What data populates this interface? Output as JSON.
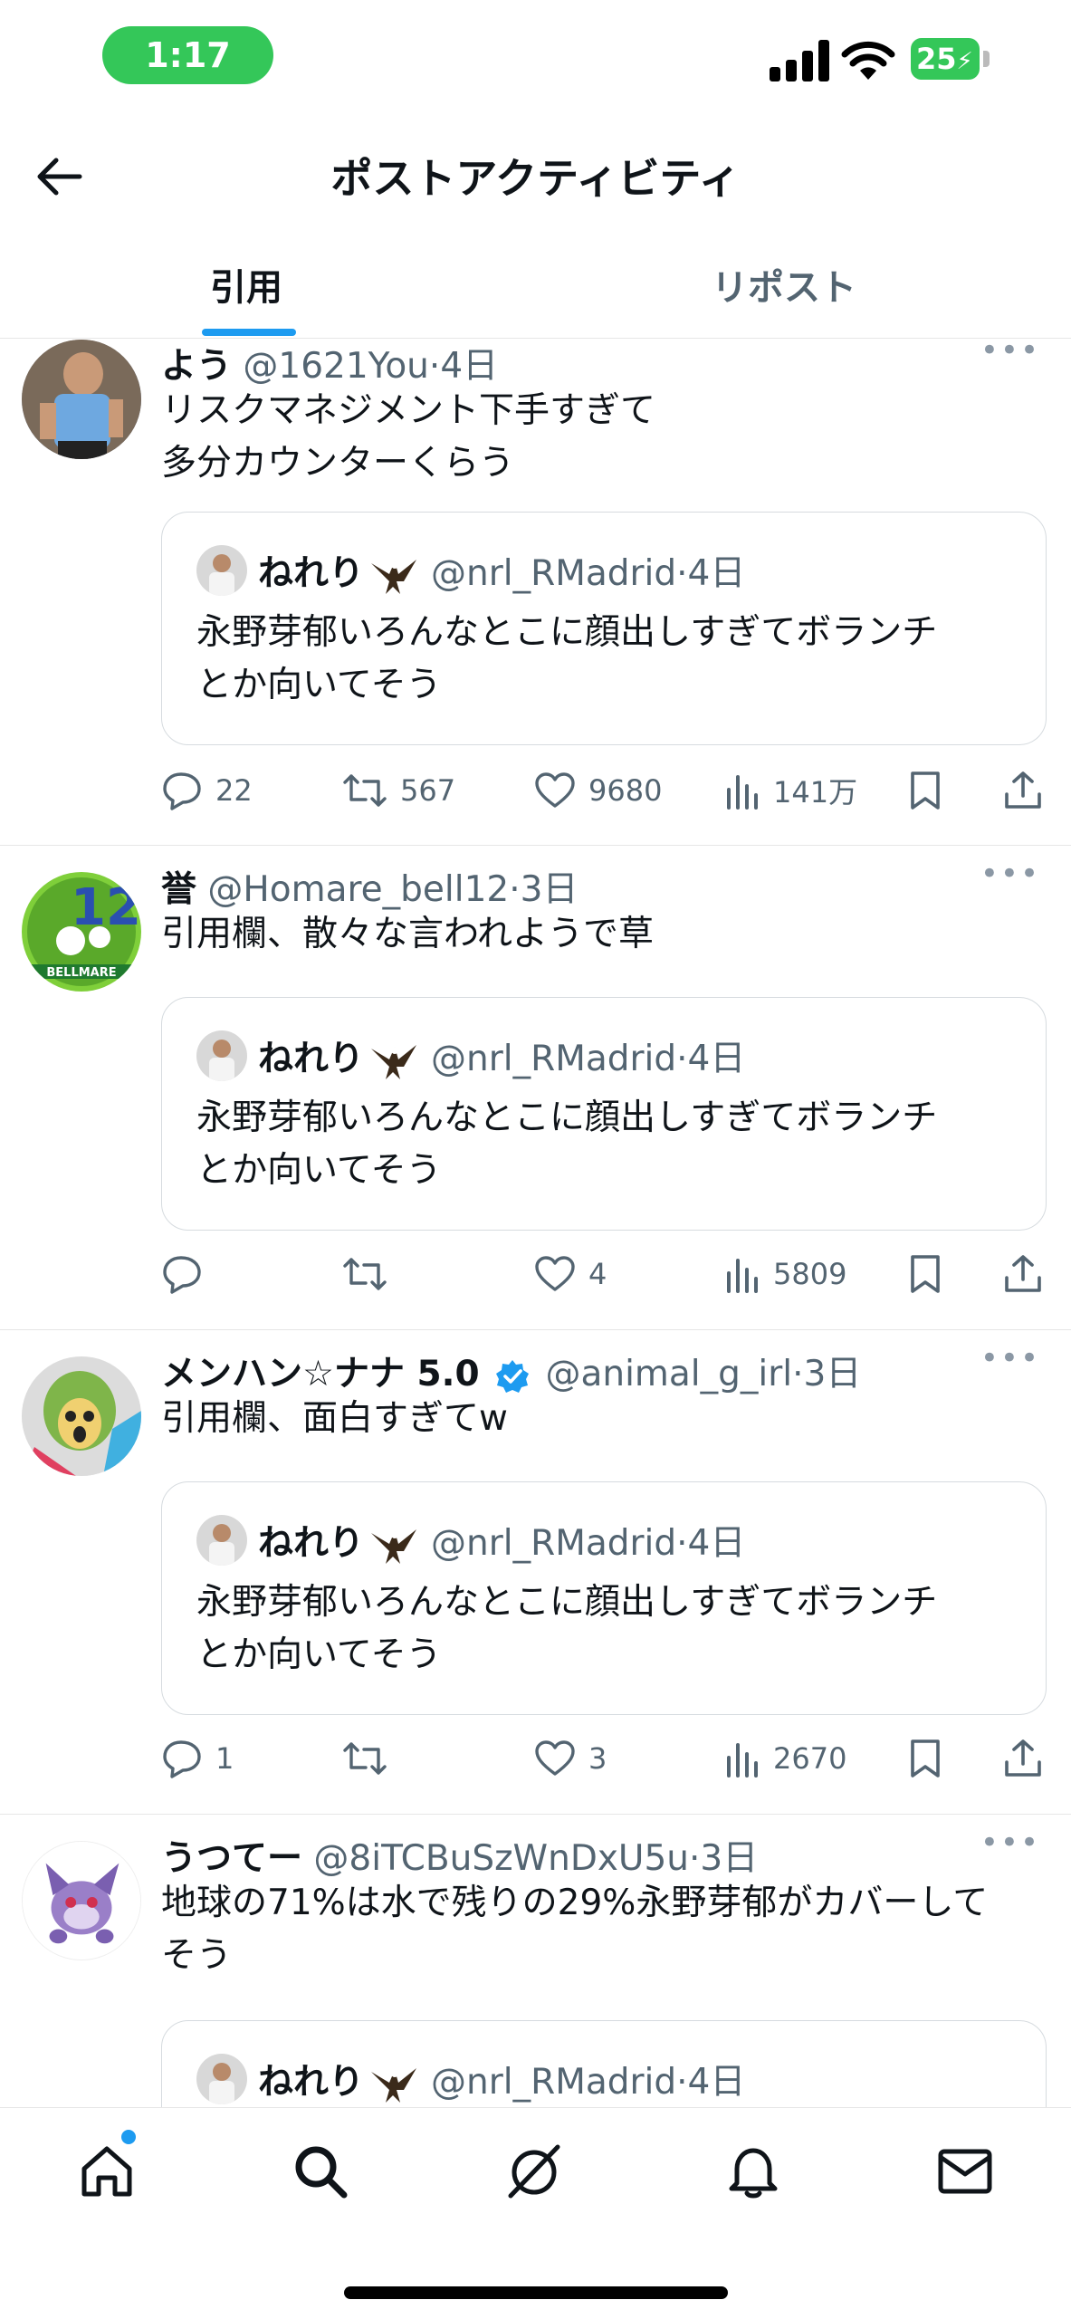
{
  "status_bar": {
    "time": "1:17",
    "battery": "25"
  },
  "header": {
    "title": "ポストアクティビティ"
  },
  "tabs": [
    {
      "label": "引用",
      "active": true
    },
    {
      "label": "リポスト",
      "active": false
    }
  ],
  "quoted_post": {
    "name": "ねれり",
    "handle": "@nrl_RMadrid",
    "time": "4日",
    "text_line1": "永野芽郁いろんなとこに顔出しすぎてボランチ",
    "text_line2": "とか向いてそう"
  },
  "posts": [
    {
      "name": "よう",
      "handle": "@1621You",
      "time": "4日",
      "text_line1": "リスクマネジメント下手すぎて",
      "text_line2": "多分カウンターくらう",
      "replies": "22",
      "reposts": "567",
      "likes": "9680",
      "views": "141万"
    },
    {
      "name": "誉",
      "handle": "@Homare_bell12",
      "time": "3日",
      "text_line1": "引用欄、散々な言われようで草",
      "replies": "",
      "reposts": "",
      "likes": "4",
      "views": "5809"
    },
    {
      "name": "メンハン☆ナナ 5.0",
      "verified": true,
      "handle": "@animal_g_irl",
      "time": "3日",
      "text_line1": "引用欄、面白すぎてw",
      "replies": "1",
      "reposts": "",
      "likes": "3",
      "views": "2670"
    },
    {
      "name": "うつてー",
      "handle": "@8iTCBuSzWnDxU5u",
      "time": "3日",
      "text_line1": "地球の71%は水で残りの29%永野芽郁がカバーして",
      "text_line2": "そう"
    }
  ],
  "avatar_text": {
    "bellmare_number": "12",
    "bellmare_label": "BELLMARE"
  },
  "colors": {
    "accent": "#1d9bf0",
    "status_green": "#34c759",
    "text": "#0f1419",
    "muted": "#536471",
    "divider": "#e6e6e6"
  },
  "icons": [
    "back-arrow-icon",
    "reply-icon",
    "repost-icon",
    "like-icon",
    "views-icon",
    "bookmark-icon",
    "share-icon",
    "home-icon",
    "search-icon",
    "grok-icon",
    "notifications-icon",
    "messages-icon",
    "verified-badge-icon"
  ]
}
